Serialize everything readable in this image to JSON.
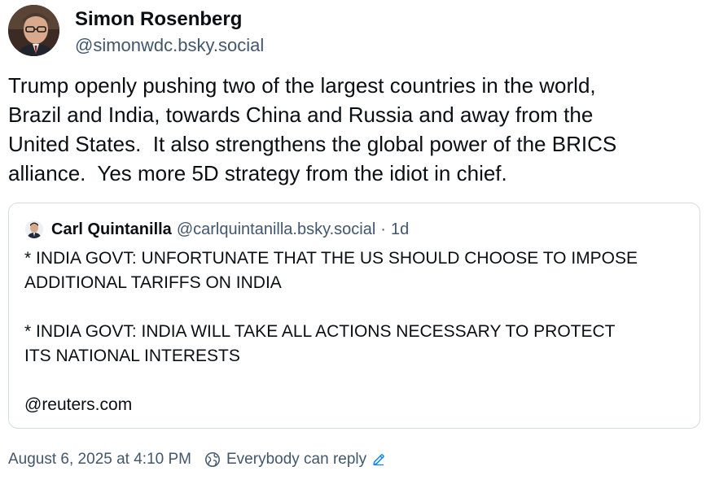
{
  "post": {
    "author": {
      "display_name": "Simon Rosenberg",
      "handle": "@simonwdc.bsky.social"
    },
    "text_lines": [
      "Trump openly pushing two of the largest countries in the world,",
      "Brazil and India, towards China and Russia and away from the",
      "United States.  It also strengthens the global power of the BRICS",
      "alliance.  Yes more 5D strategy from the idiot in chief."
    ],
    "quote": {
      "author_name": "Carl Quintanilla",
      "author_handle": "@carlquintanilla.bsky.social",
      "separator": "·",
      "age": "1d",
      "body_lines": [
        "* INDIA GOVT: UNFORTUNATE THAT THE US SHOULD CHOOSE TO IMPOSE",
        "ADDITIONAL TARIFFS ON INDIA",
        "",
        "* INDIA GOVT: INDIA WILL TAKE ALL ACTIONS NECESSARY TO PROTECT",
        "ITS NATIONAL INTERESTS",
        "",
        "@reuters.com"
      ]
    },
    "timestamp": "August 6, 2025 at 4:10 PM",
    "reply_setting": "Everybody can reply"
  },
  "icons": {
    "reply_setting_icon": "globe-icon",
    "edit_icon": "pencil-icon"
  },
  "colors": {
    "text_primary": "#0b0f14",
    "text_secondary": "#42576c",
    "link_accent": "#1083fe",
    "card_border": "#d4dbe2"
  }
}
